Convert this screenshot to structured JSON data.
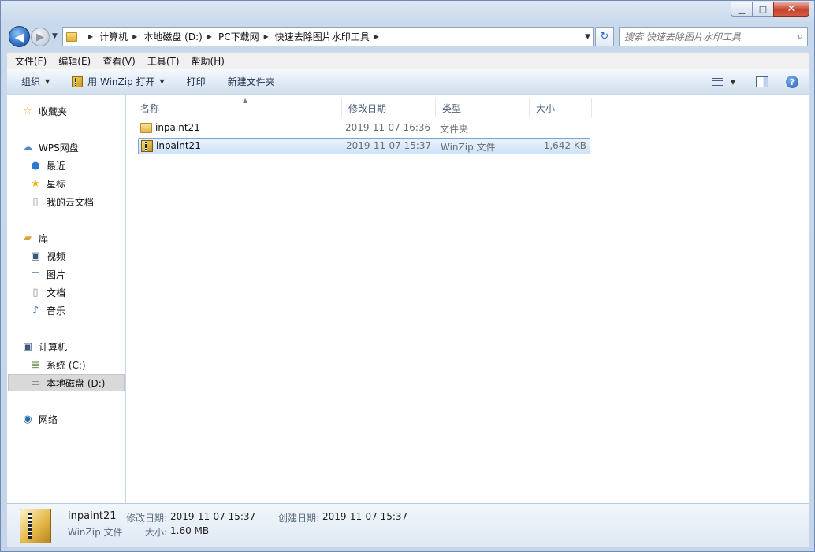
{
  "window": {
    "minimize_glyph": "▁",
    "maximize_glyph": "□",
    "close_glyph": "✕"
  },
  "nav": {
    "back_glyph": "◀",
    "forward_glyph": "▶",
    "breadcrumbs": [
      "计算机",
      "本地磁盘 (D:)",
      "PC下载网",
      "快速去除图片水印工具"
    ],
    "refresh_glyph": "↻",
    "search_placeholder": "搜索 快速去除图片水印工具",
    "search_icon": "search-icon"
  },
  "menubar": {
    "items": [
      "文件(F)",
      "编辑(E)",
      "查看(V)",
      "工具(T)",
      "帮助(H)"
    ]
  },
  "toolbar": {
    "organize": "组织",
    "open_with": "用 WinZip 打开",
    "print": "打印",
    "new_folder": "新建文件夹",
    "help_glyph": "?"
  },
  "sidebar": {
    "favorites": "收藏夹",
    "wps": "WPS网盘",
    "wps_items": [
      "最近",
      "星标",
      "我的云文档"
    ],
    "libraries": "库",
    "library_items": [
      "视频",
      "图片",
      "文档",
      "音乐"
    ],
    "computer": "计算机",
    "computer_items": [
      "系统 (C:)",
      "本地磁盘 (D:)"
    ],
    "network": "网络"
  },
  "columns": {
    "name": "名称",
    "modified": "修改日期",
    "type": "类型",
    "size": "大小"
  },
  "files": [
    {
      "name": "inpaint21",
      "modified": "2019-11-07 16:36",
      "type": "文件夹",
      "size": "",
      "icon": "folder-icon"
    },
    {
      "name": "inpaint21",
      "modified": "2019-11-07 15:37",
      "type": "WinZip 文件",
      "size": "1,642 KB",
      "icon": "winzip-icon"
    }
  ],
  "details": {
    "name": "inpaint21",
    "type": "WinZip 文件",
    "modified_label": "修改日期:",
    "modified": "2019-11-07 15:37",
    "created_label": "创建日期:",
    "created": "2019-11-07 15:37",
    "size_label": "大小:",
    "size": "1.60 MB"
  }
}
